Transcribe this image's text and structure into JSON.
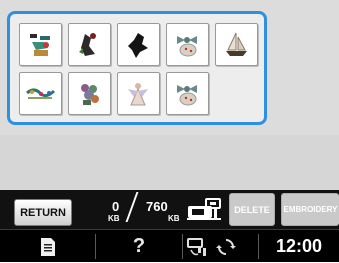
{
  "pattern_panel": {
    "patterns": [
      {
        "icon": "butterfly-cluster-pattern-icon",
        "color": "#1f8a78"
      },
      {
        "icon": "bird-figure-pattern-icon",
        "color": "#3c3030"
      },
      {
        "icon": "black-leaf-pattern-icon",
        "color": "#1a1a1a"
      },
      {
        "icon": "gift-bow-pattern-icon",
        "color": "#7a9a9a"
      },
      {
        "icon": "ship-pattern-icon",
        "color": "#5a4a3a"
      },
      {
        "icon": "floral-border-pattern-icon",
        "color": "#3f9a8a"
      },
      {
        "icon": "flower-bouquet-pattern-icon",
        "color": "#8a6a8a"
      },
      {
        "icon": "angel-figure-pattern-icon",
        "color": "#c8a898"
      },
      {
        "icon": "gift-bow-pattern-icon",
        "color": "#7a9a9a"
      }
    ]
  },
  "control_bar": {
    "return_label": "RETURN",
    "used_memory": "0",
    "used_unit": "KB",
    "total_memory": "760",
    "total_unit": "KB",
    "delete_label": "DELETE",
    "embroider_label": "EMBROIDERY"
  },
  "status_bar": {
    "help_label": "?",
    "time": "12:00"
  },
  "colors": {
    "panel_border": "#2f8fe0",
    "control_bar_bg": "#111111",
    "disabled_button": "#c9c9c9"
  }
}
